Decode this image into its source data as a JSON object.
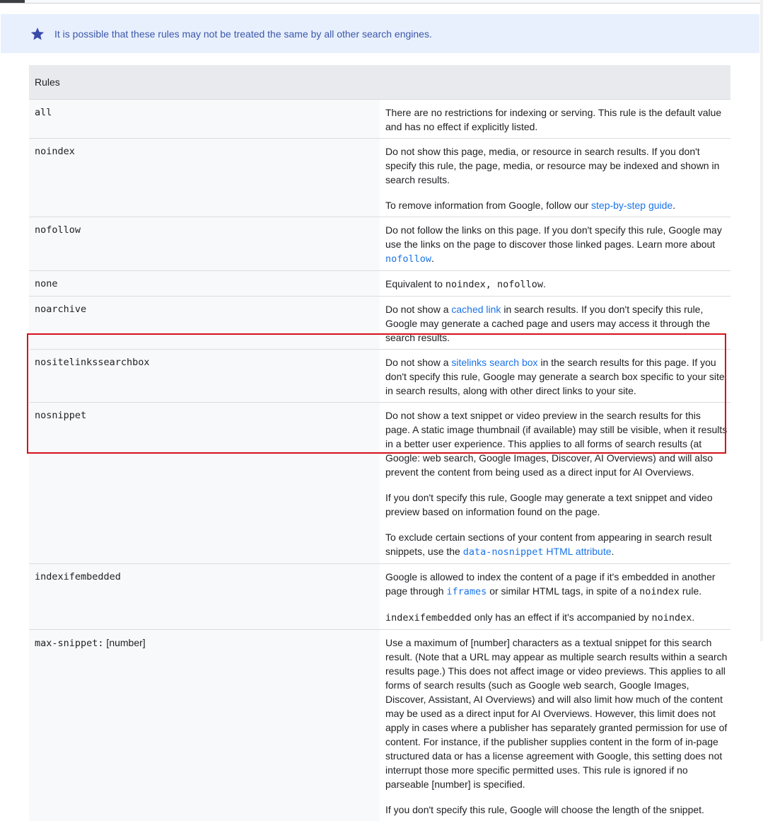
{
  "notice": {
    "text": "It is possible that these rules may not be treated the same by all other search engines.",
    "icon": "star-icon"
  },
  "table": {
    "header": "Rules",
    "rows": {
      "all": {
        "name": "all",
        "desc": "There are no restrictions for indexing or serving. This rule is the default value and has no effect if explicitly listed."
      },
      "noindex": {
        "name": "noindex",
        "p1": "Do not show this page, media, or resource in search results. If you don't specify this rule, the page, media, or resource may be indexed and shown in search results.",
        "p2_pre": "To remove information from Google, follow our ",
        "p2_link": "step-by-step guide",
        "p2_post": "."
      },
      "nofollow": {
        "name": "nofollow",
        "pre": "Do not follow the links on this page. If you don't specify this rule, Google may use the links on the page to discover those linked pages. Learn more about ",
        "link": "nofollow",
        "post": "."
      },
      "none": {
        "name": "none",
        "pre": "Equivalent to ",
        "code": "noindex, nofollow",
        "post": "."
      },
      "noarchive": {
        "name": "noarchive",
        "pre": "Do not show a ",
        "link": "cached link",
        "post": " in search results. If you don't specify this rule, Google may generate a cached page and users may access it through the search results."
      },
      "nositelinkssearchbox": {
        "name": "nositelinkssearchbox",
        "pre": "Do not show a ",
        "link": "sitelinks search box",
        "post": " in the search results for this page. If you don't specify this rule, Google may generate a search box specific to your site in search results, along with other direct links to your site."
      },
      "nosnippet": {
        "name": "nosnippet",
        "p1": "Do not show a text snippet or video preview in the search results for this page. A static image thumbnail (if available) may still be visible, when it results in a better user experience. This applies to all forms of search results (at Google: web search, Google Images, Discover, AI Overviews) and will also prevent the content from being used as a direct input for AI Overviews.",
        "p2": "If you don't specify this rule, Google may generate a text snippet and video preview based on information found on the page.",
        "p3_pre": "To exclude certain sections of your content from appearing in search result snippets, use the ",
        "p3_code_link": "data-nosnippet",
        "p3_link": " HTML attribute",
        "p3_post": "."
      },
      "indexifembedded": {
        "name": "indexifembedded",
        "p1_pre": "Google is allowed to index the content of a page if it's embedded in another page through ",
        "p1_link": "iframes",
        "p1_mid": " or similar HTML tags, in spite of a ",
        "p1_code": "noindex",
        "p1_post": " rule.",
        "p2_code1": "indexifembedded",
        "p2_mid": " only has an effect if it's accompanied by ",
        "p2_code2": "noindex",
        "p2_post": "."
      },
      "maxsnippet": {
        "name_code": "max-snippet:",
        "name_arg": " [number]",
        "p1": "Use a maximum of [number] characters as a textual snippet for this search result. (Note that a URL may appear as multiple search results within a search results page.) This does not affect image or video previews. This applies to all forms of search results (such as Google web search, Google Images, Discover, Assistant, AI Overviews) and will also limit how much of the content may be used as a direct input for AI Overviews. However, this limit does not apply in cases where a publisher has separately granted permission for use of content. For instance, if the publisher supplies content in the form of in-page structured data or has a license agreement with Google, this setting does not interrupt those more specific permitted uses. This rule is ignored if no parseable [number] is specified.",
        "p2": "If you don't specify this rule, Google will choose the length of the snippet."
      }
    }
  },
  "colors": {
    "notice_bg": "#e8f0fe",
    "notice_text": "#3c57a8",
    "link": "#1a73e8",
    "highlight": "#d4121a"
  }
}
